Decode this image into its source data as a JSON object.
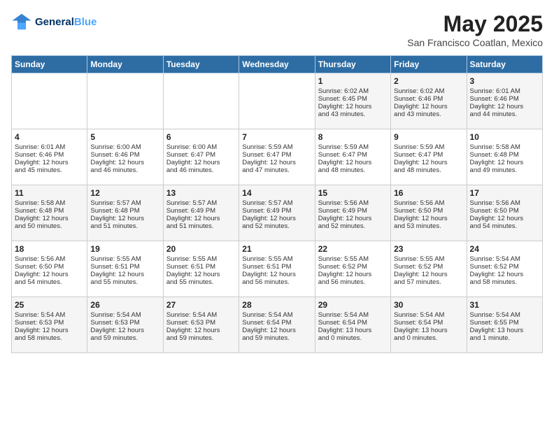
{
  "header": {
    "logo_line1": "General",
    "logo_line2": "Blue",
    "month_title": "May 2025",
    "location": "San Francisco Coatlan, Mexico"
  },
  "weekdays": [
    "Sunday",
    "Monday",
    "Tuesday",
    "Wednesday",
    "Thursday",
    "Friday",
    "Saturday"
  ],
  "weeks": [
    [
      {
        "day": "",
        "text": ""
      },
      {
        "day": "",
        "text": ""
      },
      {
        "day": "",
        "text": ""
      },
      {
        "day": "",
        "text": ""
      },
      {
        "day": "1",
        "text": "Sunrise: 6:02 AM\nSunset: 6:45 PM\nDaylight: 12 hours\nand 43 minutes."
      },
      {
        "day": "2",
        "text": "Sunrise: 6:02 AM\nSunset: 6:46 PM\nDaylight: 12 hours\nand 43 minutes."
      },
      {
        "day": "3",
        "text": "Sunrise: 6:01 AM\nSunset: 6:46 PM\nDaylight: 12 hours\nand 44 minutes."
      }
    ],
    [
      {
        "day": "4",
        "text": "Sunrise: 6:01 AM\nSunset: 6:46 PM\nDaylight: 12 hours\nand 45 minutes."
      },
      {
        "day": "5",
        "text": "Sunrise: 6:00 AM\nSunset: 6:46 PM\nDaylight: 12 hours\nand 46 minutes."
      },
      {
        "day": "6",
        "text": "Sunrise: 6:00 AM\nSunset: 6:47 PM\nDaylight: 12 hours\nand 46 minutes."
      },
      {
        "day": "7",
        "text": "Sunrise: 5:59 AM\nSunset: 6:47 PM\nDaylight: 12 hours\nand 47 minutes."
      },
      {
        "day": "8",
        "text": "Sunrise: 5:59 AM\nSunset: 6:47 PM\nDaylight: 12 hours\nand 48 minutes."
      },
      {
        "day": "9",
        "text": "Sunrise: 5:59 AM\nSunset: 6:47 PM\nDaylight: 12 hours\nand 48 minutes."
      },
      {
        "day": "10",
        "text": "Sunrise: 5:58 AM\nSunset: 6:48 PM\nDaylight: 12 hours\nand 49 minutes."
      }
    ],
    [
      {
        "day": "11",
        "text": "Sunrise: 5:58 AM\nSunset: 6:48 PM\nDaylight: 12 hours\nand 50 minutes."
      },
      {
        "day": "12",
        "text": "Sunrise: 5:57 AM\nSunset: 6:48 PM\nDaylight: 12 hours\nand 51 minutes."
      },
      {
        "day": "13",
        "text": "Sunrise: 5:57 AM\nSunset: 6:49 PM\nDaylight: 12 hours\nand 51 minutes."
      },
      {
        "day": "14",
        "text": "Sunrise: 5:57 AM\nSunset: 6:49 PM\nDaylight: 12 hours\nand 52 minutes."
      },
      {
        "day": "15",
        "text": "Sunrise: 5:56 AM\nSunset: 6:49 PM\nDaylight: 12 hours\nand 52 minutes."
      },
      {
        "day": "16",
        "text": "Sunrise: 5:56 AM\nSunset: 6:50 PM\nDaylight: 12 hours\nand 53 minutes."
      },
      {
        "day": "17",
        "text": "Sunrise: 5:56 AM\nSunset: 6:50 PM\nDaylight: 12 hours\nand 54 minutes."
      }
    ],
    [
      {
        "day": "18",
        "text": "Sunrise: 5:56 AM\nSunset: 6:50 PM\nDaylight: 12 hours\nand 54 minutes."
      },
      {
        "day": "19",
        "text": "Sunrise: 5:55 AM\nSunset: 6:51 PM\nDaylight: 12 hours\nand 55 minutes."
      },
      {
        "day": "20",
        "text": "Sunrise: 5:55 AM\nSunset: 6:51 PM\nDaylight: 12 hours\nand 55 minutes."
      },
      {
        "day": "21",
        "text": "Sunrise: 5:55 AM\nSunset: 6:51 PM\nDaylight: 12 hours\nand 56 minutes."
      },
      {
        "day": "22",
        "text": "Sunrise: 5:55 AM\nSunset: 6:52 PM\nDaylight: 12 hours\nand 56 minutes."
      },
      {
        "day": "23",
        "text": "Sunrise: 5:55 AM\nSunset: 6:52 PM\nDaylight: 12 hours\nand 57 minutes."
      },
      {
        "day": "24",
        "text": "Sunrise: 5:54 AM\nSunset: 6:52 PM\nDaylight: 12 hours\nand 58 minutes."
      }
    ],
    [
      {
        "day": "25",
        "text": "Sunrise: 5:54 AM\nSunset: 6:53 PM\nDaylight: 12 hours\nand 58 minutes."
      },
      {
        "day": "26",
        "text": "Sunrise: 5:54 AM\nSunset: 6:53 PM\nDaylight: 12 hours\nand 59 minutes."
      },
      {
        "day": "27",
        "text": "Sunrise: 5:54 AM\nSunset: 6:53 PM\nDaylight: 12 hours\nand 59 minutes."
      },
      {
        "day": "28",
        "text": "Sunrise: 5:54 AM\nSunset: 6:54 PM\nDaylight: 12 hours\nand 59 minutes."
      },
      {
        "day": "29",
        "text": "Sunrise: 5:54 AM\nSunset: 6:54 PM\nDaylight: 13 hours\nand 0 minutes."
      },
      {
        "day": "30",
        "text": "Sunrise: 5:54 AM\nSunset: 6:54 PM\nDaylight: 13 hours\nand 0 minutes."
      },
      {
        "day": "31",
        "text": "Sunrise: 5:54 AM\nSunset: 6:55 PM\nDaylight: 13 hours\nand 1 minute."
      }
    ]
  ]
}
